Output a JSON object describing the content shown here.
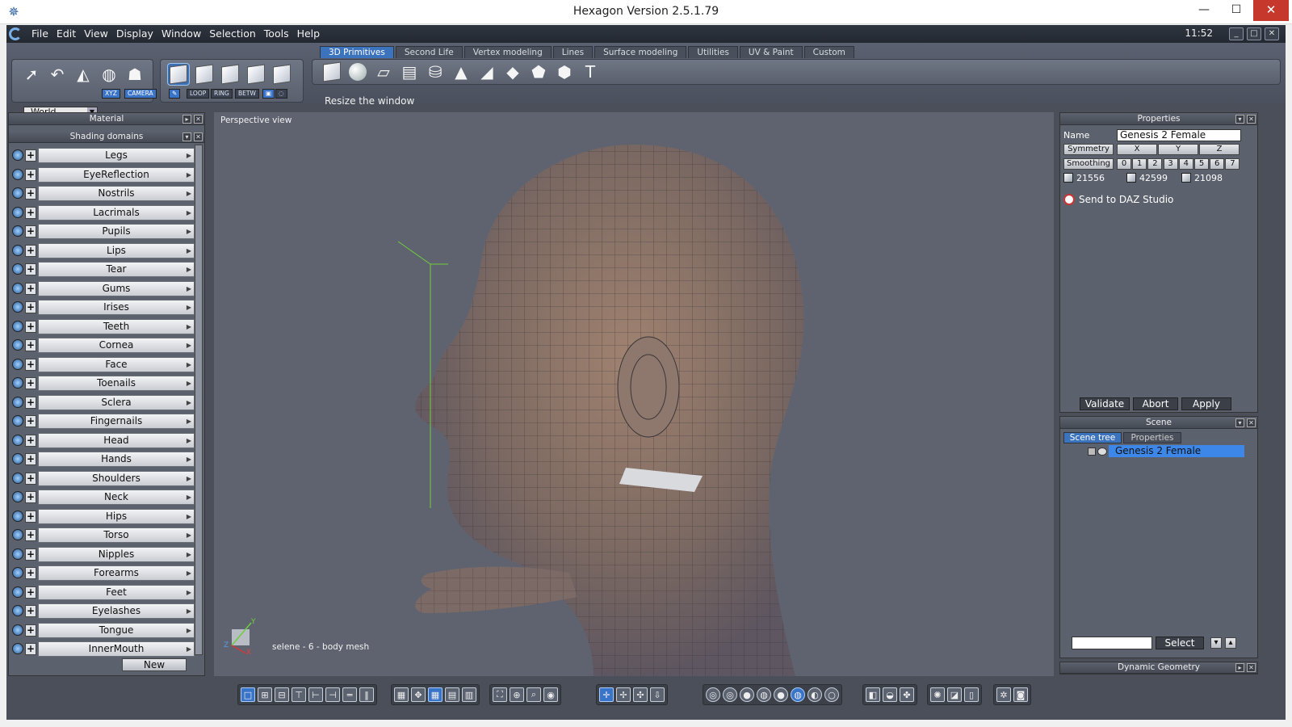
{
  "window": {
    "title": "Hexagon Version 2.5.1.79",
    "min": "—",
    "max": "☐",
    "close": "✕"
  },
  "menu": {
    "items": [
      "File",
      "Edit",
      "View",
      "Display",
      "Window",
      "Selection",
      "Tools",
      "Help"
    ],
    "clock": "11:52"
  },
  "toolbar": {
    "tabs": [
      "3D Primitives",
      "Second Life",
      "Vertex modeling",
      "Lines",
      "Surface modeling",
      "Utilities",
      "UV & Paint",
      "Custom"
    ],
    "active_tab": "3D Primitives",
    "coord_space": "World",
    "coord_buttons": [
      "XYZ",
      "CAMERA"
    ],
    "select_buttons": [
      "LOOP",
      "RING",
      "BETW"
    ],
    "status_text": "Resize the window"
  },
  "left_panel": {
    "material_title": "Material",
    "shading_title": "Shading domains",
    "domains": [
      "Legs",
      "EyeReflection",
      "Nostrils",
      "Lacrimals",
      "Pupils",
      "Lips",
      "Tear",
      "Gums",
      "Irises",
      "Teeth",
      "Cornea",
      "Face",
      "Toenails",
      "Sclera",
      "Fingernails",
      "Head",
      "Hands",
      "Shoulders",
      "Neck",
      "Hips",
      "Torso",
      "Nipples",
      "Forearms",
      "Feet",
      "Eyelashes",
      "Tongue",
      "InnerMouth"
    ],
    "new_button": "New"
  },
  "viewport": {
    "label": "Perspective view",
    "mesh_label": "selene - 6 - body mesh",
    "axis_x": "X",
    "axis_y": "Y",
    "axis_z": "Z"
  },
  "properties": {
    "title": "Properties",
    "name_label": "Name",
    "name_value": "Genesis 2 Female",
    "symmetry_label": "Symmetry",
    "symmetry_axes": [
      "X",
      "Y",
      "Z"
    ],
    "smoothing_label": "Smoothing",
    "smoothing_levels": [
      "0",
      "1",
      "2",
      "3",
      "4",
      "5",
      "6",
      "7"
    ],
    "stats": [
      "21556",
      "42599",
      "21098"
    ],
    "send_label": "Send to DAZ Studio",
    "buttons": [
      "Validate",
      "Abort",
      "Apply"
    ]
  },
  "scene": {
    "title": "Scene",
    "tabs": [
      "Scene tree",
      "Properties"
    ],
    "items": [
      "Genesis 2 Female"
    ],
    "select_button": "Select"
  },
  "dynamic_geometry": {
    "title": "Dynamic Geometry"
  }
}
